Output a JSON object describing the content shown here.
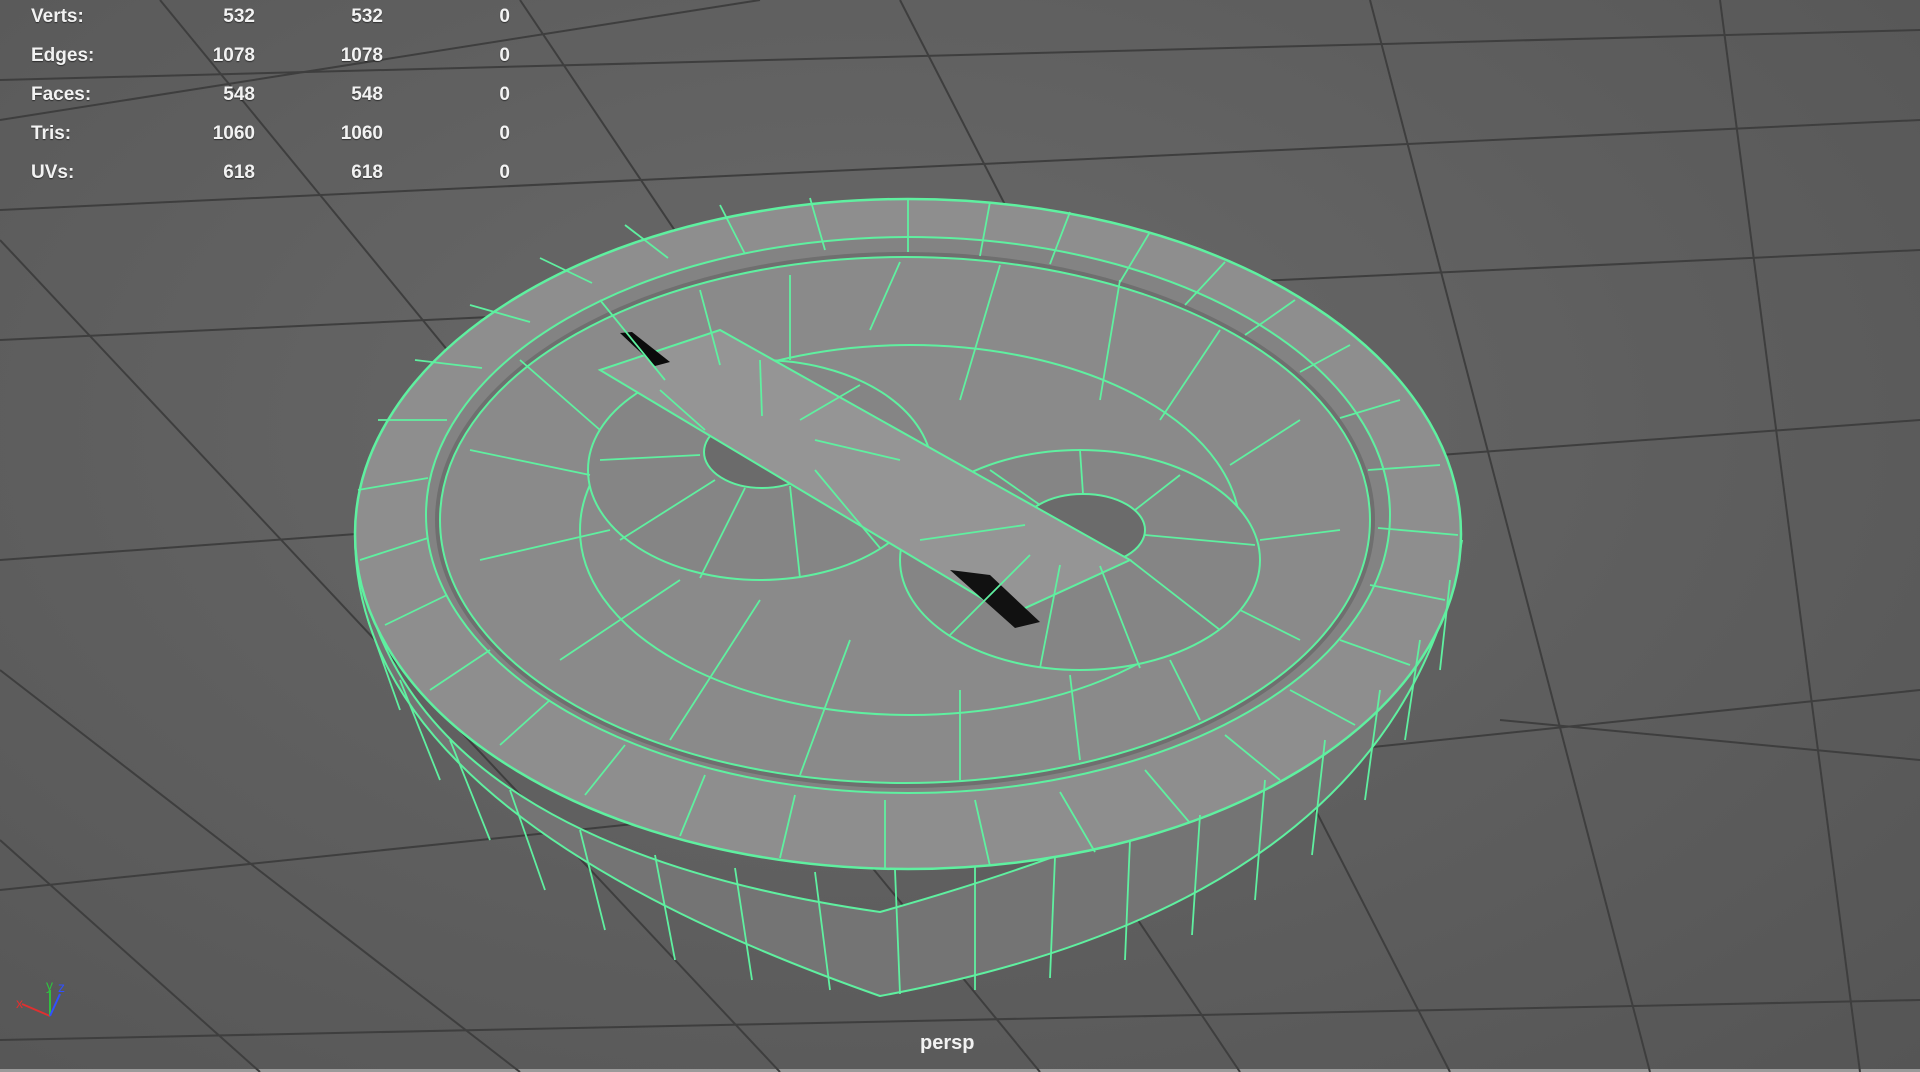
{
  "app": "Autodesk Maya viewport",
  "camera_label": "persp",
  "hud": {
    "rows": [
      {
        "label": "Verts:",
        "values": [
          "532",
          "532",
          "0"
        ]
      },
      {
        "label": "Edges:",
        "values": [
          "1078",
          "1078",
          "0"
        ]
      },
      {
        "label": "Faces:",
        "values": [
          "548",
          "548",
          "0"
        ]
      },
      {
        "label": "Tris:",
        "values": [
          "1060",
          "1060",
          "0"
        ]
      },
      {
        "label": "UVs:",
        "values": [
          "618",
          "618",
          "0"
        ]
      }
    ]
  },
  "axis_gizmo": {
    "x_label": "x",
    "y_label": "y",
    "z_label": "z"
  },
  "colors": {
    "wireframe": "#5ff0a0",
    "mesh_fill": "#8c8c8c",
    "grid": "#3f3f3f",
    "hud_text": "#f2f2f2"
  },
  "icons": [
    "axis-gizmo-icon"
  ]
}
